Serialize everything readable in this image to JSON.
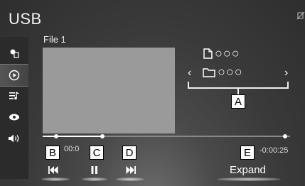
{
  "header": {
    "title": "USB"
  },
  "sidebar": {
    "items": [
      {
        "icon": "source-select-icon"
      },
      {
        "icon": "play-circle-icon",
        "active": true
      },
      {
        "icon": "playlist-icon"
      },
      {
        "icon": "eye-icon"
      },
      {
        "icon": "speaker-icon"
      }
    ]
  },
  "track": {
    "file_label": "File  1",
    "title_placeholder": "○○○",
    "folder_placeholder": "○○○"
  },
  "navigation": {
    "prev": "‹",
    "next": "›"
  },
  "progress": {
    "elapsed": "00:0",
    "remaining": "-0:00:25",
    "fraction": 0.24
  },
  "controls": {
    "prev_label": "|◀◀",
    "pause_label": "❚❚",
    "next_label": "▶▶|"
  },
  "expand": {
    "label": "Expand"
  },
  "callouts": {
    "a": "A",
    "b": "B",
    "c": "C",
    "d": "D",
    "e": "E"
  }
}
